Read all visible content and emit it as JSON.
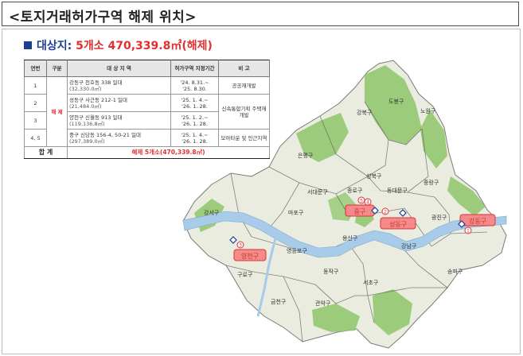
{
  "title": "<토지거래허가구역 해제 위치>",
  "summary": {
    "label": "대상지:",
    "value": "5개소 470,339.8㎡(해제)"
  },
  "table": {
    "headers": [
      "연번",
      "구분",
      "대 상 지 역",
      "허가구역 지정기간",
      "비 고"
    ],
    "category": "해 제",
    "rows": [
      {
        "no": "1",
        "area": "강동구 천호동 338 일대",
        "size": "(32,330.0㎡)",
        "period_start": "'24. 8.31.~",
        "period_end": "'25. 8.30.",
        "note": "공공재개발"
      },
      {
        "no": "2",
        "area": "성동구 사근동 212-1 일대",
        "size": "(21,484.0㎡)",
        "period_start": "'25. 1. 4.~",
        "period_end": "'26. 1. 28.",
        "note": "신속통합기획 주택재개발"
      },
      {
        "no": "3",
        "area": "양천구 신월동 913 일대",
        "size": "(119,136.8㎡)",
        "period_start": "'25. 1. 2.~",
        "period_end": "'26. 1. 28.",
        "note": ""
      },
      {
        "no": "4, 5",
        "area": "중구 신당동 156-4, 50-21 일대",
        "size": "(297,389.0㎡)",
        "period_start": "'25. 1. 4.~",
        "period_end": "'26. 1. 28.",
        "note": "모아타운 및 인근지역"
      }
    ],
    "total_label": "합 계",
    "total_value": "해제 5개소(470,339.8㎡)"
  },
  "map": {
    "colors": {
      "land": "#e9ecdf",
      "green": "#8fc56b",
      "river": "#a7cbe8",
      "highlight": "#f48a8a"
    },
    "districts": [
      "도봉구",
      "노원구",
      "강북구",
      "은평구",
      "성북구",
      "중랑구",
      "종로구",
      "동대문구",
      "서대문구",
      "마포구",
      "광진구",
      "강서구",
      "영등포구",
      "용산구",
      "동작구",
      "서초구",
      "강남구",
      "송파구",
      "구로구",
      "금천구",
      "관악구"
    ],
    "highlighted": [
      {
        "name": "중구",
        "marker": "4"
      },
      {
        "name": "성동구",
        "marker": "2"
      },
      {
        "name": "강동구",
        "marker": "1"
      },
      {
        "name": "양천구",
        "marker": "3"
      }
    ],
    "extra_marker": "5"
  }
}
